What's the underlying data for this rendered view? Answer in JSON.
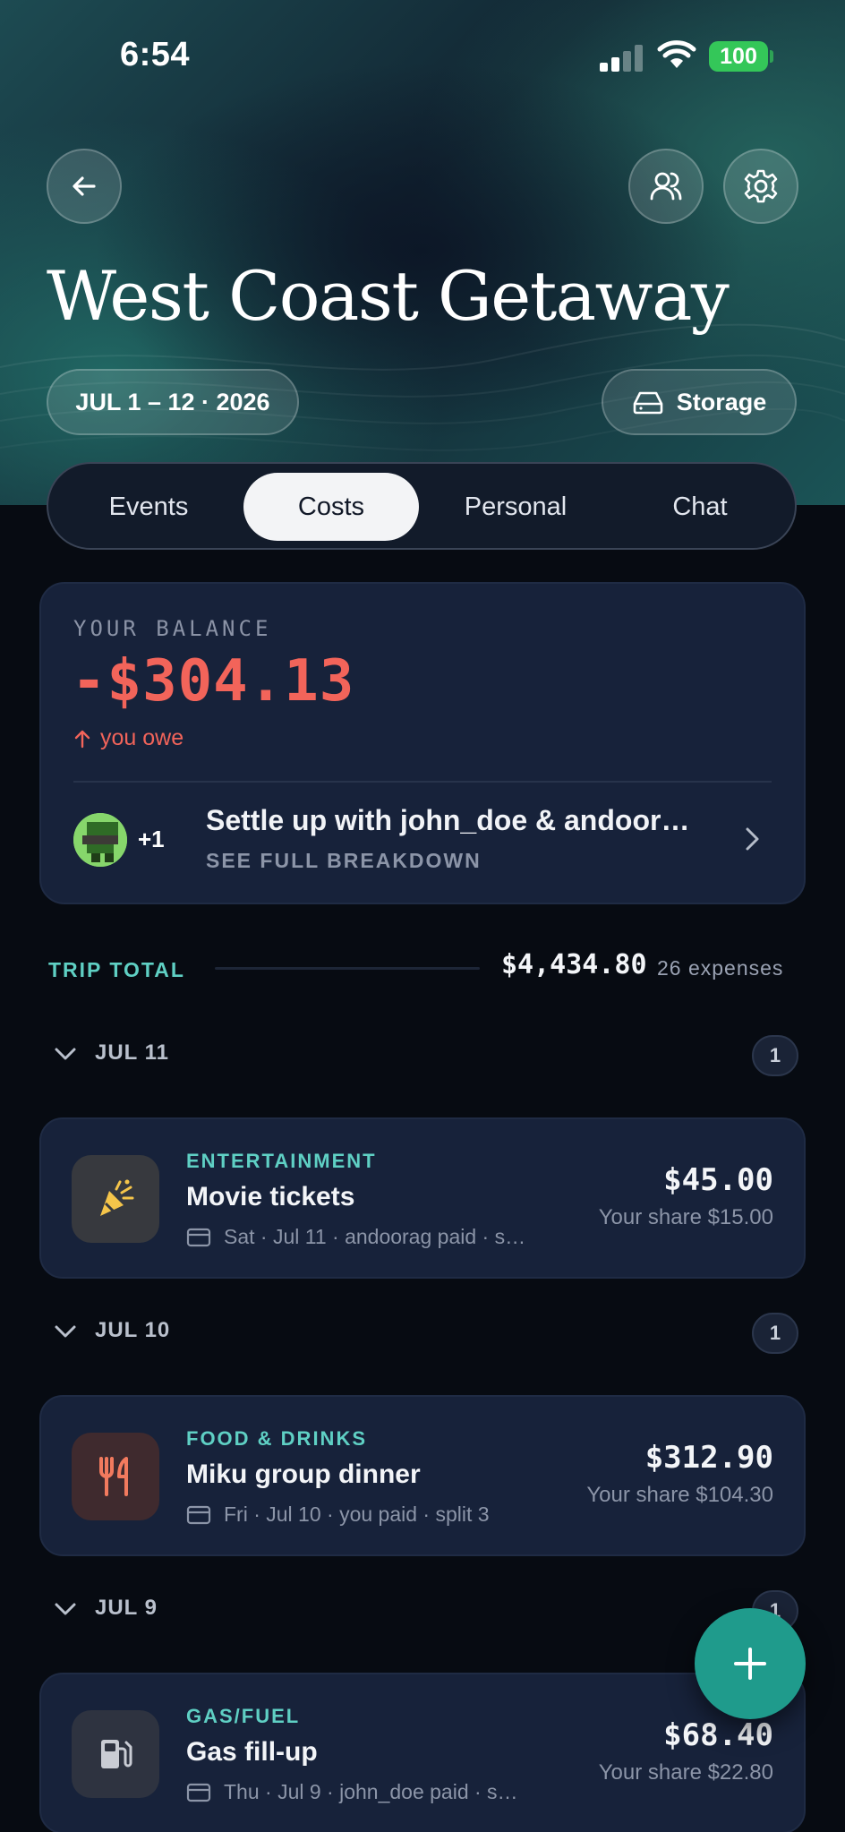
{
  "status_bar": {
    "time": "6:54",
    "battery": "100",
    "signal_icon": "cellular-signal-icon",
    "wifi_icon": "wifi-icon"
  },
  "header": {
    "back_icon": "arrow-left-icon",
    "members_icon": "users-icon",
    "settings_icon": "gear-icon",
    "title": "West Coast Getaway",
    "dates": "JUL 1 – 12 · 2026",
    "storage_label": "Storage",
    "storage_icon": "hard-drive-icon"
  },
  "tabs": [
    {
      "label": "Events",
      "active": false
    },
    {
      "label": "Costs",
      "active": true
    },
    {
      "label": "Personal",
      "active": false
    },
    {
      "label": "Chat",
      "active": false
    }
  ],
  "balance": {
    "label": "YOUR BALANCE",
    "amount": "-$304.13",
    "direction": "you owe",
    "settle": {
      "extra_count": "+1",
      "title": "Settle up with john_doe & andoor…",
      "subtitle": "SEE FULL BREAKDOWN"
    }
  },
  "trip_total": {
    "label": "TRIP TOTAL",
    "amount": "$4,434.80",
    "count": "26 expenses"
  },
  "groups": [
    {
      "date": "JUL 11",
      "count": "1",
      "expense": {
        "category": "ENTERTAINMENT",
        "name": "Movie tickets",
        "meta": "Sat · Jul 11 · andoorag paid · s…",
        "amount": "$45.00",
        "share": "Your share $15.00",
        "icon": "party-popper-icon"
      }
    },
    {
      "date": "JUL 10",
      "count": "1",
      "expense": {
        "category": "FOOD & DRINKS",
        "name": "Miku group dinner",
        "meta": "Fri · Jul 10 · you paid · split 3",
        "amount": "$312.90",
        "share": "Your share $104.30",
        "icon": "utensils-icon"
      }
    },
    {
      "date": "JUL 9",
      "count": "1",
      "expense": {
        "category": "GAS/FUEL",
        "name": "Gas fill-up",
        "meta": "Thu · Jul 9 · john_doe paid · s…",
        "amount": "$68.40",
        "share": "Your share $22.80",
        "icon": "fuel-pump-icon"
      }
    }
  ],
  "colors": {
    "accent_teal": "#5fd0c4",
    "negative": "#f2645a",
    "card": "#17223a",
    "background": "#070b12",
    "fab": "#1f9b8c"
  }
}
